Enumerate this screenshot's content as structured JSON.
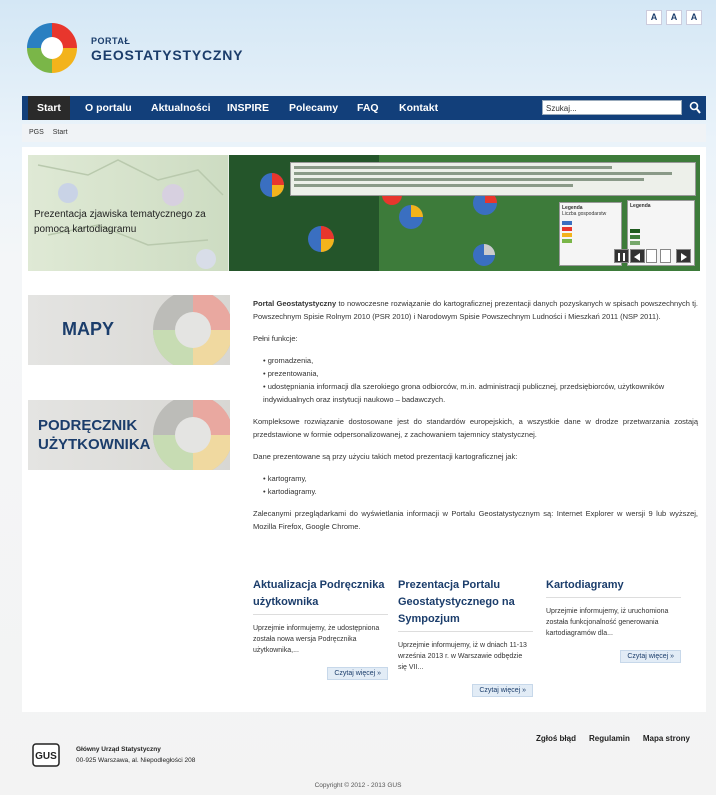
{
  "header": {
    "logo_small": "PORTAŁ",
    "logo_big": "GEOSTATYSTYCZNY",
    "font_size_buttons": [
      "A",
      "A",
      "A"
    ]
  },
  "nav": {
    "items": [
      "Start",
      "O portalu",
      "Aktualności",
      "INSPIRE",
      "Polecamy",
      "FAQ",
      "Kontakt"
    ],
    "search_value": "Szukaj..."
  },
  "breadcrumb": [
    "PGS",
    "Start"
  ],
  "slider": {
    "caption": "Prezentacja zjawiska tematycznego za pomocą kartodiagramu",
    "legend_title": "Legenda",
    "legend_subtitle": "Liczba gospodarstw"
  },
  "banners": {
    "maps": "MAPY",
    "manual_line1": "PODRĘCZNIK",
    "manual_line2": "UŻYTKOWNIKA"
  },
  "main": {
    "intro_bold": "Portal Geostatystyczny",
    "intro_rest": " to nowoczesne rozwiązanie do kartograficznej prezentacji danych pozyskanych w spisach powszechnych tj. Powszechnym Spisie Rolnym 2010 (PSR 2010) i Narodowym Spisie Powszechnym Ludności i Mieszkań 2011 (NSP 2011).",
    "functions_label": "Pełni funkcje:",
    "functions": [
      "gromadzenia,",
      "prezentowania,",
      "udostępniania informacji dla szerokiego grona odbiorców, m.in. administracji publicznej, przedsiębiorców, użytkowników indywidualnych oraz instytucji naukowo – badawczych."
    ],
    "p2": "Kompleksowe rozwiązanie dostosowane jest do standardów europejskich, a wszystkie dane w drodze przetwarzania zostają przedstawione w formie odpersonalizowanej, z zachowaniem tajemnicy statystycznej.",
    "methods_label": "Dane prezentowane są przy użyciu takich metod prezentacji kartograficznej jak:",
    "methods": [
      "kartogramy,",
      "kartodiagramy."
    ],
    "p3": "Zalecanymi przeglądarkami do wyświetlania informacji w Portalu Geostatystycznym są: Internet Explorer w wersji 9 lub wyższej, Mozilla Firefox, Google Chrome."
  },
  "news": [
    {
      "title": "Aktualizacja Podręcznika użytkownika",
      "text": "Uprzejmie informujemy, że udostępniona została nowa wersja Podręcznika użytkownika,...",
      "more": "Czytaj więcej »"
    },
    {
      "title": "Prezentacja Portalu Geostatystycznego na Sympozjum",
      "text": "Uprzejmie informujemy, iż w dniach 11-13 września 2013 r. w Warszawie odbędzie się VII...",
      "more": "Czytaj więcej »"
    },
    {
      "title": "Kartodiagramy",
      "text": "Uprzejmie informujemy, iż uruchomiona została funkcjonalność generowania kartodiagramów dla...",
      "more": "Czytaj więcej »"
    }
  ],
  "footer": {
    "logo_text": "GUS",
    "org_name": "Główny Urząd Statystyczny",
    "address": "00-925 Warszawa, al. Niepodległości 208",
    "links": [
      "Zgłoś błąd",
      "Regulamin",
      "Mapa strony"
    ],
    "copyright": "Copyright © 2012 - 2013 GUS"
  },
  "colors": {
    "nav": "#123f7a",
    "accent": "#1b3d6b",
    "map_green": "#3d7b3a"
  }
}
